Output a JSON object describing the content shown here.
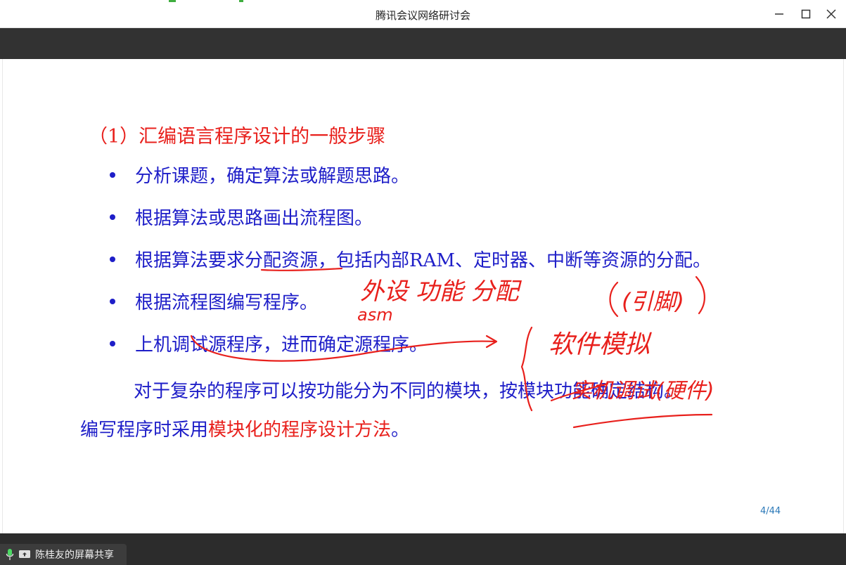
{
  "window": {
    "title": "腾讯会议网络研讨会",
    "controls": [
      "minimize-icon",
      "maximize-icon",
      "close-icon"
    ]
  },
  "slide": {
    "heading": "（1）汇编语言程序设计的一般步骤",
    "bullets": [
      "分析课题，确定算法或解题思路。",
      "根据算法或思路画出流程图。",
      "根据算法要求分配资源，包括内部RAM、定时器、中断等资源的分配。",
      "根据流程图编写程序。",
      "上机调试源程序，进而确定源程序。"
    ],
    "paragraph": {
      "line1": "对于复杂的程序可以按功能分为不同的模块，按模块功能确定结构。",
      "line2_prefix": "编写程序时采用",
      "line2_highlight": "模块化的程序设计方法",
      "line2_suffix": "。"
    },
    "page_number": "4/44",
    "annotations": {
      "note1": "外设 功能 分配",
      "note2": "(引脚)",
      "note3": "asm",
      "note4": "软件模拟",
      "note5": "实机调试(硬件)"
    }
  },
  "share_bar": {
    "label": "陈桂友的屏幕共享",
    "icons": [
      "microphone-icon",
      "screen-share-icon"
    ]
  },
  "colors": {
    "heading_red": "#e8201c",
    "body_blue": "#1e1ec8",
    "ink_red": "#e8201c",
    "toolbar_dark": "#323232"
  }
}
